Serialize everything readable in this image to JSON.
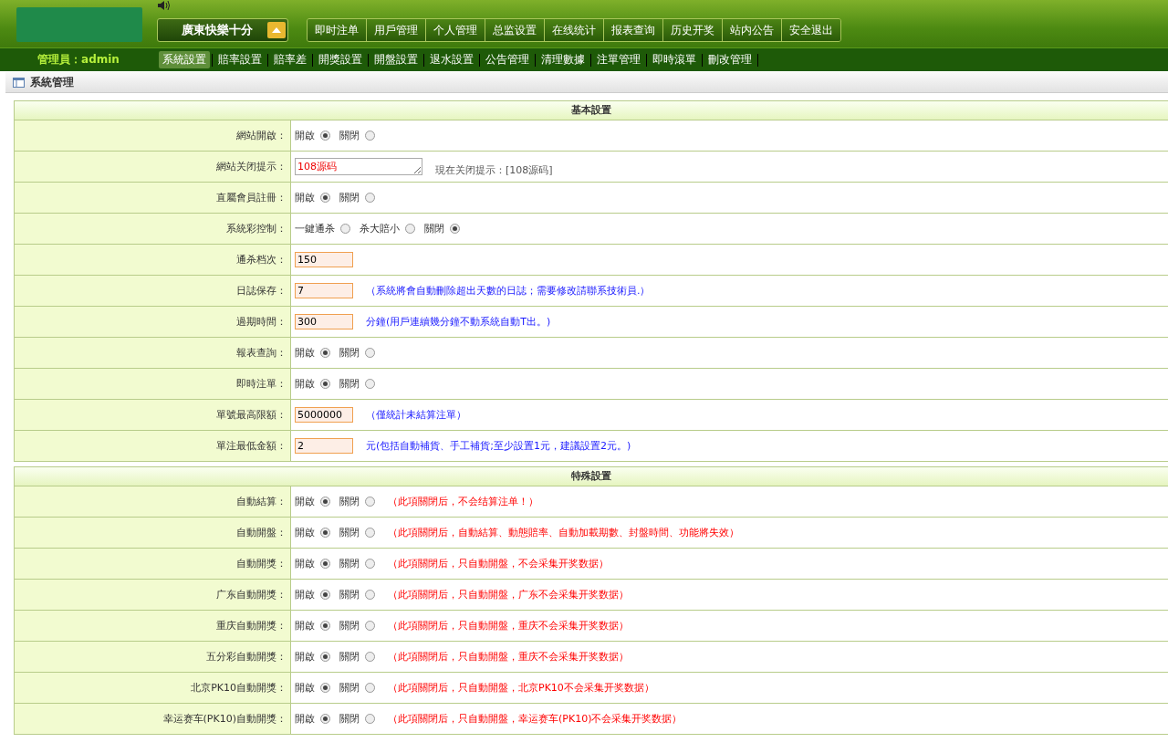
{
  "header": {
    "game": "廣東快樂十分",
    "nav": [
      "即时注单",
      "用戶管理",
      "个人管理",
      "总监设置",
      "在线统计",
      "报表查询",
      "历史开奖",
      "站内公告",
      "安全退出"
    ]
  },
  "subnav": {
    "admin": "管理員：admin",
    "items": [
      {
        "label": "系統設置",
        "selected": true
      },
      {
        "label": "賠率設置",
        "selected": false
      },
      {
        "label": "賠率差",
        "selected": false
      },
      {
        "label": "開獎設置",
        "selected": false
      },
      {
        "label": "開盤設置",
        "selected": false
      },
      {
        "label": "退水設置",
        "selected": false
      },
      {
        "label": "公告管理",
        "selected": false
      },
      {
        "label": "清理數據",
        "selected": false
      },
      {
        "label": "注單管理",
        "selected": false
      },
      {
        "label": "即時滾單",
        "selected": false
      },
      {
        "label": "刪改管理",
        "selected": false
      }
    ]
  },
  "panel": {
    "title": "系統管理"
  },
  "sections": [
    {
      "title": "基本設置",
      "rows": [
        {
          "label": "網站開啟：",
          "kind": "radio",
          "options": [
            {
              "label": "開啟",
              "selected": true
            },
            {
              "label": "關閉",
              "selected": false
            }
          ]
        },
        {
          "label": "網站关闭提示：",
          "kind": "textarea",
          "value": "108源码",
          "note": {
            "text": "現在关闭提示：[108源码]",
            "kind": "current"
          }
        },
        {
          "label": "直屬會員註冊：",
          "kind": "radio",
          "options": [
            {
              "label": "開啟",
              "selected": true
            },
            {
              "label": "關閉",
              "selected": false
            }
          ]
        },
        {
          "label": "系統彩控制：",
          "kind": "radio",
          "options": [
            {
              "label": "一鍵通杀",
              "selected": false
            },
            {
              "label": "杀大賠小",
              "selected": false
            },
            {
              "label": "關閉",
              "selected": true
            }
          ]
        },
        {
          "label": "通杀档次：",
          "kind": "input",
          "value": "150"
        },
        {
          "label": "日誌保存：",
          "kind": "input",
          "value": "7",
          "note": {
            "text": "（系統將會自動刪除超出天數的日誌；需要修改請聯系技術員.）",
            "kind": "hint"
          }
        },
        {
          "label": "過期時間：",
          "kind": "input",
          "value": "300",
          "note": {
            "text": "分鐘(用戶連續幾分鐘不動系統自動T出。)",
            "kind": "hint"
          }
        },
        {
          "label": "報表查詢：",
          "kind": "radio",
          "options": [
            {
              "label": "開啟",
              "selected": true
            },
            {
              "label": "關閉",
              "selected": false
            }
          ]
        },
        {
          "label": "即時注單：",
          "kind": "radio",
          "options": [
            {
              "label": "開啟",
              "selected": true
            },
            {
              "label": "關閉",
              "selected": false
            }
          ]
        },
        {
          "label": "單號最高限額：",
          "kind": "input",
          "value": "5000000",
          "note": {
            "text": "（僅統計未結算注單）",
            "kind": "hint"
          }
        },
        {
          "label": "單注最低金額：",
          "kind": "input",
          "value": "2",
          "note": {
            "text": "元(包括自動補貨、手工補貨;至少設置1元，建議設置2元。)",
            "kind": "hint"
          }
        }
      ]
    },
    {
      "title": "特殊設置",
      "rows": [
        {
          "label": "自動結算：",
          "kind": "radio",
          "options": [
            {
              "label": "開啟",
              "selected": true
            },
            {
              "label": "關閉",
              "selected": false
            }
          ],
          "note": {
            "text": "（此項關閉后，不会结算注单！）",
            "kind": "warning"
          }
        },
        {
          "label": "自動開盤：",
          "kind": "radio",
          "options": [
            {
              "label": "開啟",
              "selected": true
            },
            {
              "label": "關閉",
              "selected": false
            }
          ],
          "note": {
            "text": "（此項關閉后，自動結算、動態賠率、自動加載期數、封盤時間、功能將失效）",
            "kind": "warning"
          }
        },
        {
          "label": "自動開獎：",
          "kind": "radio",
          "options": [
            {
              "label": "開啟",
              "selected": true
            },
            {
              "label": "關閉",
              "selected": false
            }
          ],
          "note": {
            "text": "（此項關閉后，只自動開盤，不会采集开奖数据）",
            "kind": "warning"
          }
        },
        {
          "label": "广东自動開獎：",
          "kind": "radio",
          "options": [
            {
              "label": "開啟",
              "selected": true
            },
            {
              "label": "關閉",
              "selected": false
            }
          ],
          "note": {
            "text": "（此項關閉后，只自動開盤，广东不会采集开奖数据）",
            "kind": "warning"
          }
        },
        {
          "label": "重庆自動開獎：",
          "kind": "radio",
          "options": [
            {
              "label": "開啟",
              "selected": true
            },
            {
              "label": "關閉",
              "selected": false
            }
          ],
          "note": {
            "text": "（此項關閉后，只自動開盤，重庆不会采集开奖数据）",
            "kind": "warning"
          }
        },
        {
          "label": "五分彩自動開獎：",
          "kind": "radio",
          "options": [
            {
              "label": "開啟",
              "selected": true
            },
            {
              "label": "關閉",
              "selected": false
            }
          ],
          "note": {
            "text": "（此項關閉后，只自動開盤，重庆不会采集开奖数据）",
            "kind": "warning"
          }
        },
        {
          "label": "北京PK10自動開獎：",
          "kind": "radio",
          "options": [
            {
              "label": "開啟",
              "selected": true
            },
            {
              "label": "關閉",
              "selected": false
            }
          ],
          "note": {
            "text": "（此項關閉后，只自動開盤，北京PK10不会采集开奖数据）",
            "kind": "warning"
          }
        },
        {
          "label": "幸运赛车(PK10)自動開獎：",
          "kind": "radio",
          "options": [
            {
              "label": "開啟",
              "selected": true
            },
            {
              "label": "關閉",
              "selected": false
            }
          ],
          "note": {
            "text": "（此項關閉后，只自動開盤，幸运赛车(PK10)不会采集开奖数据）",
            "kind": "warning"
          }
        }
      ]
    }
  ]
}
